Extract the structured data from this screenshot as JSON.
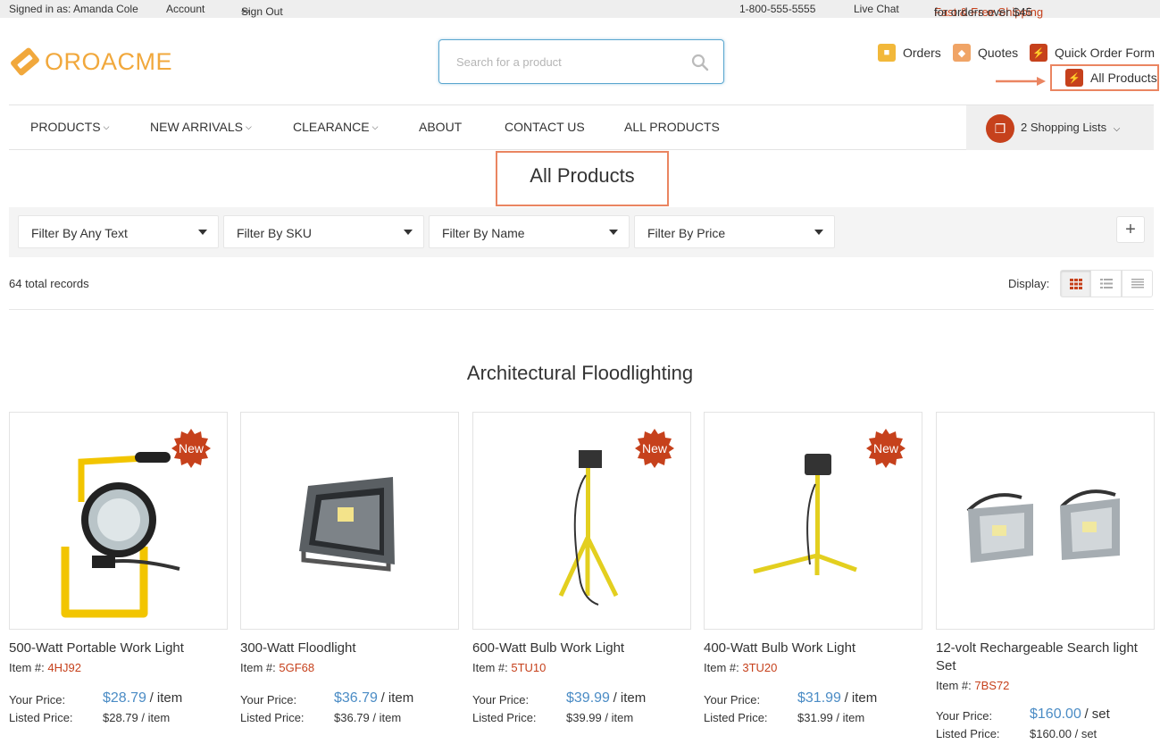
{
  "topbar": {
    "signed_in": "Signed in as: Amanda Cole",
    "account": "Account",
    "sign_out": "Sign Out",
    "phone": "1-800-555-5555",
    "live_chat": "Live Chat",
    "shipping_accent": "Fast & Free Shipping",
    "shipping_rest": "for orders over $45"
  },
  "header": {
    "logo_text": "OROACME",
    "search_placeholder": "Search for a product",
    "orders": "Orders",
    "quotes": "Quotes",
    "quick_order": "Quick Order Form",
    "all_products": "All Products"
  },
  "nav": {
    "items": [
      {
        "label": "Products",
        "dropdown": true
      },
      {
        "label": "New Arrivals",
        "dropdown": true
      },
      {
        "label": "Clearance",
        "dropdown": true
      },
      {
        "label": "About",
        "dropdown": false
      },
      {
        "label": "Contact Us",
        "dropdown": false
      },
      {
        "label": "All Products",
        "dropdown": false
      }
    ],
    "shopping_lists": "2 Shopping Lists"
  },
  "page": {
    "title": "All Products",
    "total_records": "64 total records",
    "display_label": "Display:",
    "section_title": "Architectural Floodlighting"
  },
  "filters": [
    {
      "label": "Filter By Any Text"
    },
    {
      "label": "Filter By SKU"
    },
    {
      "label": "Filter By Name"
    },
    {
      "label": "Filter By Price"
    }
  ],
  "labels": {
    "item": "Item #:",
    "your_price": "Your Price:",
    "listed_price": "Listed Price:",
    "new_badge": "New"
  },
  "products": [
    {
      "name": "500-Watt Portable Work Light",
      "sku": "4HJ92",
      "your_price": "$28.79",
      "your_unit": "/ item",
      "listed": "$28.79 / item",
      "is_new": true
    },
    {
      "name": "300-Watt Floodlight",
      "sku": "5GF68",
      "your_price": "$36.79",
      "your_unit": "/ item",
      "listed": "$36.79 / item",
      "is_new": false
    },
    {
      "name": "600-Watt Bulb Work Light",
      "sku": "5TU10",
      "your_price": "$39.99",
      "your_unit": "/ item",
      "listed": "$39.99 / item",
      "is_new": true
    },
    {
      "name": "400-Watt Bulb Work Light",
      "sku": "3TU20",
      "your_price": "$31.99",
      "your_unit": "/ item",
      "listed": "$31.99 / item",
      "is_new": true
    },
    {
      "name": "12-volt Rechargeable Search light Set",
      "sku": "7BS72",
      "your_price": "$160.00",
      "your_unit": "/ set",
      "listed": "$160.00 / set",
      "is_new": false
    }
  ],
  "colors": {
    "accent": "#c6411c",
    "logo": "#f1a83c",
    "price": "#4b8cc5",
    "highlight": "#ea8561"
  }
}
